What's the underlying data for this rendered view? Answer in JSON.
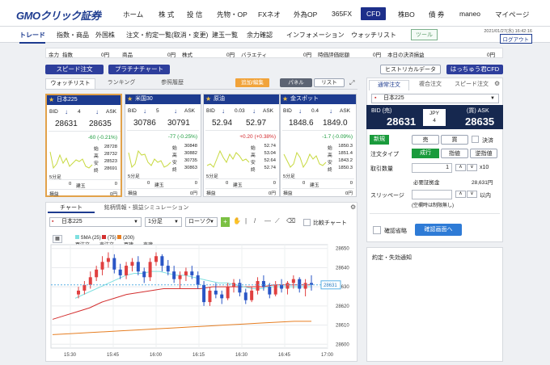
{
  "header": {
    "logo": "GMOクリック証券",
    "nav": [
      "ホーム",
      "株 式",
      "投 信",
      "先物・OP",
      "FXネオ",
      "外為OP",
      "365FX",
      "CFD",
      "株BO",
      "債 券",
      "maneo",
      "マイページ"
    ],
    "active_nav": "CFD"
  },
  "subnav": {
    "items": [
      "トレード",
      "指数・商品",
      "外国株",
      "注文・約定一覧(取消・変更)",
      "建玉一覧",
      "余力確認",
      "インフォメーション",
      "ウォッチリスト"
    ],
    "tool_label": "ツール",
    "datetime": "2021/01/27(水) 16:42:16",
    "logout": "ログアウト"
  },
  "account": {
    "items": [
      {
        "label": "余力",
        "sub": "指数",
        "value": "0円"
      },
      {
        "label": "",
        "sub": "商品",
        "value": "0円"
      },
      {
        "label": "",
        "sub": "株式",
        "value": "0円"
      },
      {
        "label": "",
        "sub": "バラエティ",
        "value": "0円"
      },
      {
        "label": "",
        "sub": "時価評価総額",
        "value": "0円"
      },
      {
        "label": "",
        "sub": "本日の決済損益",
        "value": "0円"
      }
    ]
  },
  "toolbar": {
    "speed": "スピード注文",
    "platinum": "プラチナチャート",
    "historical": "ヒストリカルデータ",
    "hacchou": "はっちゅう君CFD"
  },
  "watch": {
    "tabs": [
      "ウォッチリスト",
      "ランキング",
      "参照履歴"
    ],
    "add_edit": "追加/編集",
    "panel": "パネル",
    "list": "リスト"
  },
  "cards": [
    {
      "name": "日本225",
      "spread": "4",
      "bid": "28631",
      "ask": "28635",
      "change": "-60 (-0.21%)",
      "change_color": "#1a9b3c",
      "ohlc": [
        [
          "始",
          "28728"
        ],
        [
          "高",
          "28732"
        ],
        [
          "安",
          "28523"
        ],
        [
          "終",
          "28691"
        ]
      ],
      "tf": "5分足",
      "tate": "0",
      "tategyoku": "建玉",
      "gyo": "0",
      "son": "損益",
      "pl": "0円"
    },
    {
      "name": "米国30",
      "spread": "5",
      "bid": "30786",
      "ask": "30791",
      "change": "-77 (-0.25%)",
      "change_color": "#1a9b3c",
      "ohlc": [
        [
          "始",
          "30848"
        ],
        [
          "高",
          "30882"
        ],
        [
          "安",
          "30735"
        ],
        [
          "終",
          "30863"
        ]
      ],
      "tf": "5分足",
      "tate": "0",
      "tategyoku": "建玉",
      "gyo": "0",
      "son": "損益",
      "pl": "0円"
    },
    {
      "name": "原油",
      "spread": "0.03",
      "bid": "52.94",
      "ask": "52.97",
      "change": "+0.20 (+0.38%)",
      "change_color": "#d3282c",
      "ohlc": [
        [
          "始",
          "52.74"
        ],
        [
          "高",
          "53.04"
        ],
        [
          "安",
          "52.64"
        ],
        [
          "終",
          "52.74"
        ]
      ],
      "tf": "5分足",
      "tate": "0",
      "tategyoku": "建玉",
      "gyo": "0",
      "son": "損益",
      "pl": "0円"
    },
    {
      "name": "金スポット",
      "spread": "0.4",
      "bid": "1848.6",
      "ask": "1849.0",
      "change": "-1.7 (-0.09%)",
      "change_color": "#1a9b3c",
      "ohlc": [
        [
          "始",
          "1850.3"
        ],
        [
          "高",
          "1851.4"
        ],
        [
          "安",
          "1843.2"
        ],
        [
          "終",
          "1850.3"
        ]
      ],
      "tf": "5分足",
      "tate": "0",
      "tategyoku": "建玉",
      "gyo": "0",
      "son": "損益",
      "pl": "0円"
    }
  ],
  "chart_panel": {
    "tabs": [
      "チャート",
      "銘柄情報・損益シミュレーション"
    ],
    "symbol": "日本225",
    "timeframe": "1分足",
    "style": "ローソク",
    "compare": "比較チャート",
    "legend_sma": "SMA",
    "legend_vals": [
      "(25)",
      "(75)",
      "(200)"
    ],
    "legend_orders": [
      "買注文",
      "売注文",
      "買建",
      "売建"
    ],
    "current_price": "28631"
  },
  "chart_data": {
    "type": "candlestick",
    "x_ticks": [
      "15:30",
      "15:45",
      "16:00",
      "16:15",
      "16:30",
      "16:45",
      "17:00"
    ],
    "y_ticks": [
      "28650",
      "28640",
      "28630",
      "28620",
      "28610",
      "28600"
    ],
    "ylim": [
      28598,
      28652
    ],
    "candles": [
      [
        28626,
        28630,
        28624,
        28628
      ],
      [
        28628,
        28633,
        28626,
        28631
      ],
      [
        28631,
        28638,
        28629,
        28635
      ],
      [
        28635,
        28641,
        28633,
        28639
      ],
      [
        28639,
        28646,
        28636,
        28643
      ],
      [
        28643,
        28648,
        28640,
        28645
      ],
      [
        28645,
        28647,
        28637,
        28639
      ],
      [
        28639,
        28642,
        28634,
        28636
      ],
      [
        28636,
        28643,
        28634,
        28641
      ],
      [
        28641,
        28645,
        28638,
        28643
      ],
      [
        28643,
        28646,
        28636,
        28638
      ],
      [
        28638,
        28640,
        28632,
        28635
      ],
      [
        28635,
        28645,
        28633,
        28643
      ],
      [
        28643,
        28648,
        28641,
        28646
      ],
      [
        28646,
        28647,
        28638,
        28641
      ],
      [
        28641,
        28644,
        28636,
        28638
      ],
      [
        28638,
        28641,
        28632,
        28634
      ],
      [
        28634,
        28638,
        28629,
        28636
      ],
      [
        28636,
        28640,
        28633,
        28638
      ],
      [
        28638,
        28641,
        28634,
        28636
      ],
      [
        28636,
        28638,
        28629,
        28631
      ],
      [
        28631,
        28633,
        28620,
        28622
      ],
      [
        28622,
        28630,
        28620,
        28628
      ],
      [
        28628,
        28632,
        28624,
        28626
      ],
      [
        28626,
        28628,
        28621,
        28624
      ],
      [
        28624,
        28632,
        28623,
        28630
      ],
      [
        28630,
        28634,
        28627,
        28632
      ],
      [
        28632,
        28634,
        28625,
        28627
      ],
      [
        28627,
        28629,
        28621,
        28623
      ],
      [
        28623,
        28630,
        28622,
        28628
      ],
      [
        28628,
        28635,
        28626,
        28633
      ],
      [
        28633,
        28636,
        28628,
        28630
      ],
      [
        28630,
        28632,
        28624,
        28626
      ],
      [
        28626,
        28633,
        28625,
        28631
      ],
      [
        28631,
        28634,
        28627,
        28629
      ],
      [
        28629,
        28633,
        28626,
        28632
      ],
      [
        28632,
        28636,
        28629,
        28634
      ],
      [
        28634,
        28635,
        28627,
        28629
      ],
      [
        28629,
        28634,
        28625,
        28632
      ],
      [
        28632,
        28636,
        28628,
        28631
      ]
    ],
    "sma25": [
      28624,
      28626,
      28628,
      28630,
      28632,
      28634,
      28636,
      28637,
      28637,
      28638,
      28638,
      28637,
      28636,
      28636,
      28635,
      28634,
      28633,
      28632,
      28632,
      28631,
      28630,
      28629,
      28629,
      28630,
      28630,
      28630,
      28630,
      28630,
      28630
    ],
    "sma75": [
      28613,
      28615,
      28617,
      28619,
      28622,
      28624,
      28626,
      28627,
      28628,
      28629,
      28629,
      28629,
      28629,
      28630,
      28630,
      28630,
      28630,
      28630,
      28631,
      28631,
      28631,
      28631
    ],
    "sma200": [
      28605,
      28605.5,
      28606,
      28606.5,
      28607,
      28607.5,
      28608,
      28608.5,
      28609,
      28609.5,
      28610,
      28610.5,
      28611,
      28611.5,
      28612,
      28612
    ]
  },
  "order": {
    "tabs": [
      "通常注文",
      "複合注文",
      "スピード注文"
    ],
    "symbol": "日本225",
    "bid_label": "BID (売)",
    "ask_label": "(買) ASK",
    "bid": "28631",
    "ask": "28635",
    "currency": "JPY",
    "spread": "4",
    "new": "新規",
    "sell": "売",
    "buy": "買",
    "settle": "決済",
    "type_label": "注文タイプ",
    "types": [
      "成行",
      "指値",
      "逆指値"
    ],
    "qty_label": "取引数量",
    "qty": "1",
    "qty_unit": "x10",
    "margin_label": "必要証拠金",
    "margin": "28,631円",
    "slip_label": "スリッページ",
    "slip_unit": "以内",
    "slip_note": "(空欄時は制限無し)",
    "confirm_skip": "確認省略",
    "confirm_btn": "確認画面へ",
    "notice": "約定・失効通知"
  }
}
